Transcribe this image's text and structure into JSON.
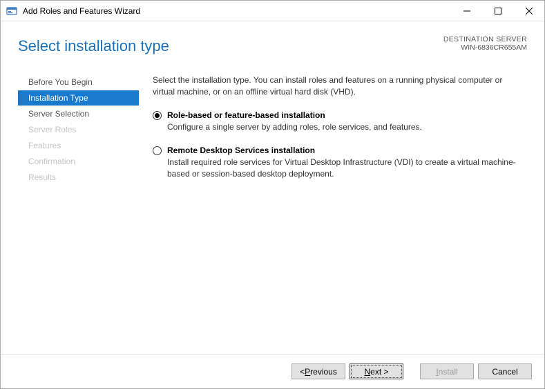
{
  "window": {
    "title": "Add Roles and Features Wizard"
  },
  "heading": "Select installation type",
  "destination": {
    "label": "DESTINATION SERVER",
    "name": "WIN-6836CR655AM"
  },
  "sidebar": {
    "items": [
      {
        "label": "Before You Begin",
        "state": "normal"
      },
      {
        "label": "Installation Type",
        "state": "active"
      },
      {
        "label": "Server Selection",
        "state": "normal"
      },
      {
        "label": "Server Roles",
        "state": "disabled"
      },
      {
        "label": "Features",
        "state": "disabled"
      },
      {
        "label": "Confirmation",
        "state": "disabled"
      },
      {
        "label": "Results",
        "state": "disabled"
      }
    ]
  },
  "main": {
    "intro": "Select the installation type. You can install roles and features on a running physical computer or virtual machine, or on an offline virtual hard disk (VHD).",
    "options": [
      {
        "title": "Role-based or feature-based installation",
        "desc": "Configure a single server by adding roles, role services, and features.",
        "selected": true
      },
      {
        "title": "Remote Desktop Services installation",
        "desc": "Install required role services for Virtual Desktop Infrastructure (VDI) to create a virtual machine-based or session-based desktop deployment.",
        "selected": false
      }
    ]
  },
  "footer": {
    "previous_prefix": "< ",
    "previous_underline": "P",
    "previous_rest": "revious",
    "next_underline": "N",
    "next_rest": "ext >",
    "install_underline": "I",
    "install_rest": "nstall",
    "cancel": "Cancel"
  }
}
